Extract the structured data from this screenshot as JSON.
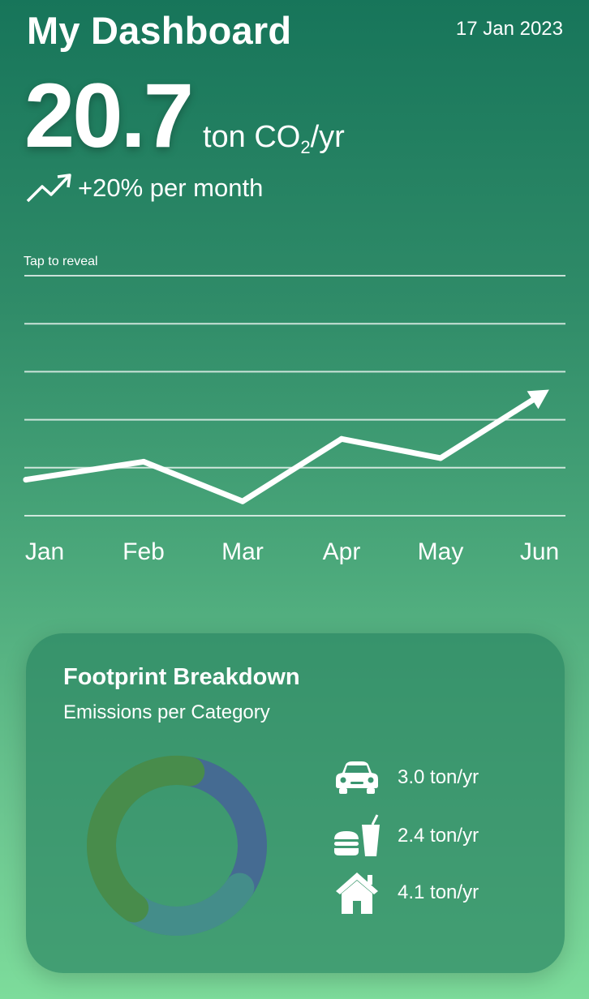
{
  "header": {
    "title": "My Dashboard",
    "date": "17 Jan 2023"
  },
  "metric": {
    "value": "20.7",
    "unit_prefix": "ton CO",
    "unit_sub": "2",
    "unit_suffix": "/yr"
  },
  "trend": {
    "icon": "trend-up-icon",
    "text": "+20% per month"
  },
  "chart_hint": "Tap to reveal",
  "chart_data": {
    "type": "line",
    "categories": [
      "Jan",
      "Feb",
      "Mar",
      "Apr",
      "May",
      "Jun"
    ],
    "values": [
      3.0,
      4.5,
      1.2,
      6.4,
      4.8,
      10.0
    ],
    "ylim": [
      0,
      20
    ],
    "grid": true,
    "ytick_labels": false,
    "end_arrow": true,
    "line_color": "#ffffff"
  },
  "breakdown": {
    "title": "Footprint Breakdown",
    "subtitle": "Emissions per Category",
    "items": [
      {
        "icon": "car-icon",
        "value": "3.0 ton/yr",
        "amount": 3.0,
        "color": "#456b92"
      },
      {
        "icon": "food-icon",
        "value": "2.4 ton/yr",
        "amount": 2.4,
        "color": "#448d8a"
      },
      {
        "icon": "home-icon",
        "value": "4.1 ton/yr",
        "amount": 4.1,
        "color": "#488c4b"
      }
    ]
  },
  "colors": {
    "background_top": "#17755a",
    "background_bottom": "#7ddc9b",
    "card": "#2c8864"
  }
}
